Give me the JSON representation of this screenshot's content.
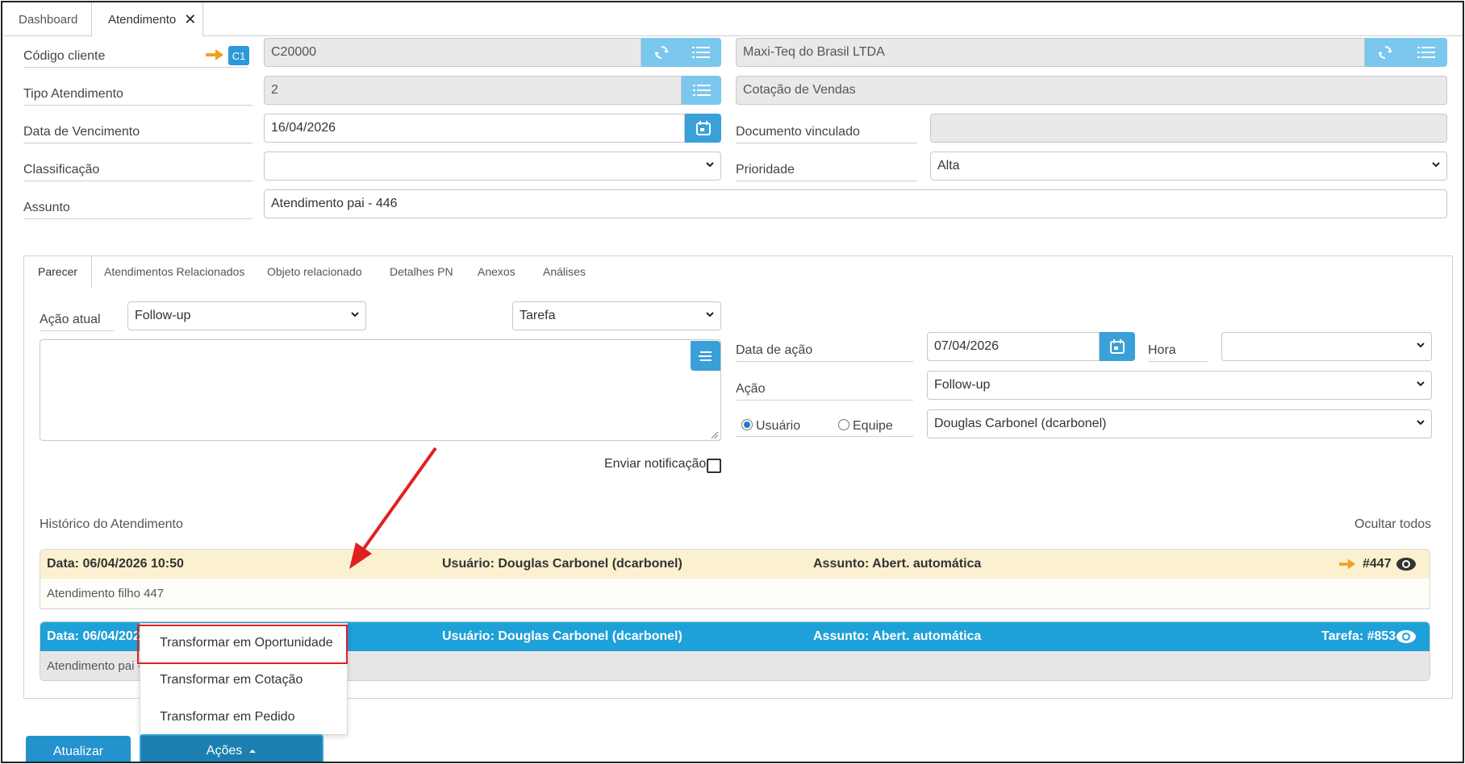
{
  "tabs": {
    "dashboard": "Dashboard",
    "atendimento": "Atendimento"
  },
  "form": {
    "codigo_cliente_label": "Código cliente",
    "badge": "C1",
    "codigo_cliente_value": "C20000",
    "cliente_nome": "Maxi-Teq do Brasil LTDA",
    "tipo_atendimento_label": "Tipo Atendimento",
    "tipo_atendimento_value": "2",
    "tipo_atendimento_desc": "Cotação de Vendas",
    "data_vencimento_label": "Data de Vencimento",
    "data_vencimento_value": "16/04/2026",
    "documento_vinculado_label": "Documento vinculado",
    "classificacao_label": "Classificação",
    "prioridade_label": "Prioridade",
    "prioridade_value": "Alta",
    "assunto_label": "Assunto",
    "assunto_value": "Atendimento pai - 446"
  },
  "panel_tabs": [
    "Parecer",
    "Atendimentos Relacionados",
    "Objeto relacionado",
    "Detalhes PN",
    "Anexos",
    "Análises"
  ],
  "parecer": {
    "acao_atual_label": "Ação atual",
    "acao_atual_value": "Follow-up",
    "tipo_value": "Tarefa",
    "data_acao_label": "Data de ação",
    "data_acao_value": "07/04/2026",
    "hora_label": "Hora",
    "acao_label": "Ação",
    "acao_value": "Follow-up",
    "usuario_label": "Usuário",
    "equipe_label": "Equipe",
    "usuario_value": "Douglas Carbonel (dcarbonel)",
    "enviar_notificacao_label": "Enviar notificação"
  },
  "historico": {
    "title": "Histórico do Atendimento",
    "ocultar_todos": "Ocultar todos",
    "entries": [
      {
        "data": "Data: 06/04/2026 10:50",
        "usuario": "Usuário: Douglas Carbonel (dcarbonel)",
        "assunto": "Assunto: Abert. automática",
        "ref": "#447",
        "body": "Atendimento filho 447"
      },
      {
        "data": "Data: 06/04/202",
        "usuario": "Usuário: Douglas Carbonel (dcarbonel)",
        "assunto": "Assunto: Abert. automática",
        "ref": "Tarefa: #853",
        "body": "Atendimento pai -"
      }
    ]
  },
  "menu": {
    "items": [
      "Transformar em Oportunidade",
      "Transformar em Cotação",
      "Transformar em Pedido"
    ]
  },
  "buttons": {
    "atualizar": "Atualizar",
    "acoes": "Ações"
  },
  "colors": {
    "accent": "#3aa0d8",
    "highlight_row": "#fbf0cf",
    "active_row": "#1ea0d9",
    "annotation": "#e02020",
    "arrow": "#f0a020"
  }
}
